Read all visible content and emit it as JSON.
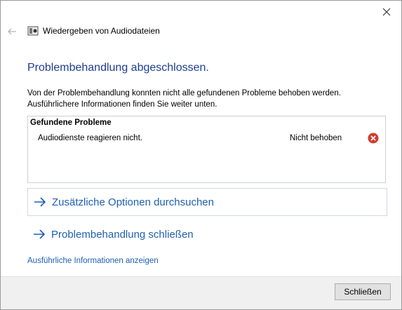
{
  "header": {
    "title": "Wiedergeben von Audiodateien",
    "icons": {
      "close": "close-icon",
      "back": "back-arrow-icon",
      "app": "speaker-app-icon"
    }
  },
  "main": {
    "heading": "Problembehandlung abgeschlossen.",
    "description_line1": "Von der Problembehandlung konnten nicht alle gefundenen Probleme behoben werden.",
    "description_line2": "Ausführlichere Informationen finden Sie weiter unten.",
    "problems": {
      "title": "Gefundene Probleme",
      "items": [
        {
          "text": "Audiodienste reagieren nicht.",
          "status": "Nicht behoben",
          "icon": "error-icon",
          "icon_color": "#d33c2a"
        }
      ]
    },
    "options": {
      "more_options_label": "Zusätzliche Optionen durchsuchen",
      "close_troubleshooter_label": "Problembehandlung schließen"
    },
    "details_link": "Ausführliche Informationen anzeigen"
  },
  "footer": {
    "close_button": "Schließen"
  },
  "colors": {
    "heading": "#1e3d8f",
    "link": "#1f5fb0",
    "error": "#d33c2a"
  }
}
